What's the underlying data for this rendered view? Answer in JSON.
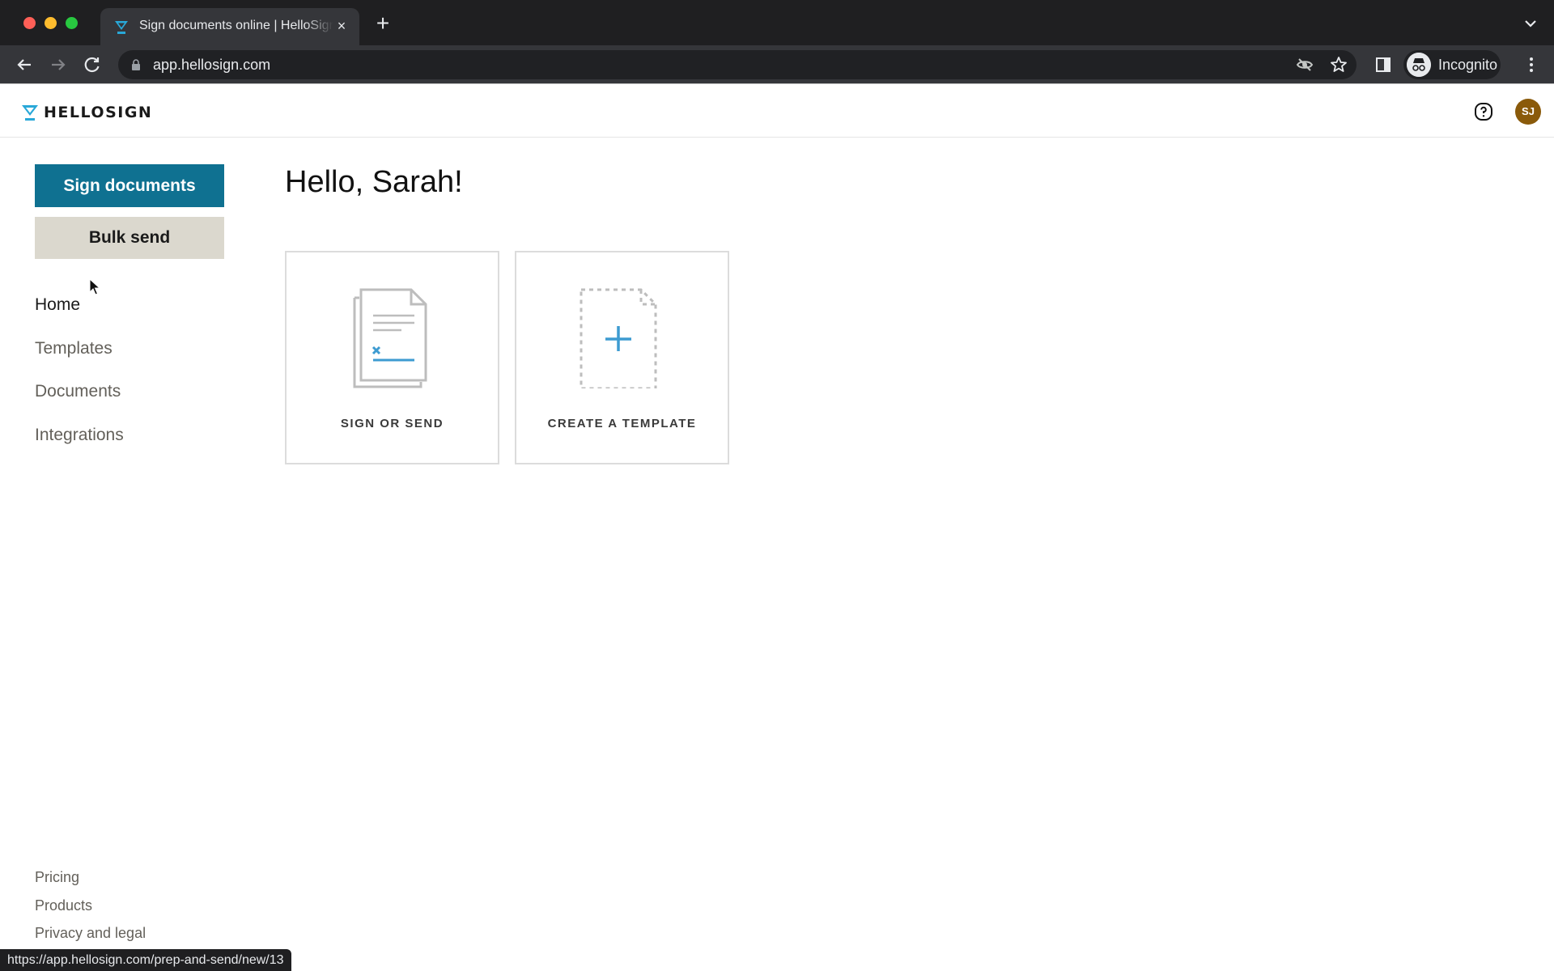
{
  "browser": {
    "tab_title": "Sign documents online | HelloSign",
    "url": "app.hellosign.com",
    "profile_label": "Incognito",
    "status_url": "https://app.hellosign.com/prep-and-send/new/13",
    "icons": {
      "tab_close": "×",
      "new_tab": "+"
    }
  },
  "header": {
    "brand": "HELLOSIGN",
    "avatar_initials": "SJ",
    "colors": {
      "brand": "#29a8d8",
      "avatar": "#8a5a0a"
    }
  },
  "sidebar": {
    "primary_button": "Sign documents",
    "secondary_button": "Bulk send",
    "nav": [
      {
        "label": "Home",
        "active": true
      },
      {
        "label": "Templates",
        "active": false
      },
      {
        "label": "Documents",
        "active": false
      },
      {
        "label": "Integrations",
        "active": false
      }
    ],
    "footer_links": [
      "Pricing",
      "Products",
      "Privacy and legal"
    ],
    "colors": {
      "primary": "#0f7191",
      "secondary": "#dbd8ce"
    }
  },
  "main": {
    "greeting": "Hello, Sarah!",
    "cards": [
      {
        "label": "SIGN OR SEND",
        "icon": "document-sign-icon"
      },
      {
        "label": "CREATE A TEMPLATE",
        "icon": "new-template-icon"
      }
    ]
  }
}
